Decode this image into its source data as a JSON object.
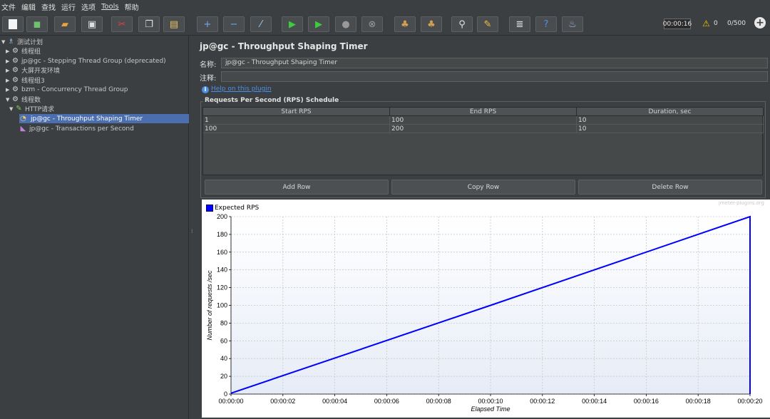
{
  "menu": [
    "文件",
    "编辑",
    "查找",
    "运行",
    "选项",
    "Tools",
    "帮助"
  ],
  "toolbar": {
    "elapsed": "00:00:16",
    "warning_count": "0",
    "threads": "0/500"
  },
  "tree": [
    {
      "label": "测试计划",
      "icon": "flask-icon",
      "depth": 0,
      "expanded": true
    },
    {
      "label": "线程组",
      "icon": "gear-icon",
      "depth": 1
    },
    {
      "label": "jp@gc - Stepping Thread Group (deprecated)",
      "icon": "gear-icon",
      "depth": 1
    },
    {
      "label": "大屏开发环境",
      "icon": "gear-icon",
      "depth": 1
    },
    {
      "label": "线程组3",
      "icon": "gear-icon",
      "depth": 1
    },
    {
      "label": "bzm - Concurrency Thread Group",
      "icon": "gear-icon",
      "depth": 1
    },
    {
      "label": "线程数",
      "icon": "gear-icon",
      "depth": 1,
      "expanded": true
    },
    {
      "label": "HTTP请求",
      "icon": "pencil-icon",
      "depth": 2,
      "expanded": true
    },
    {
      "label": "jp@gc - Throughput Shaping Timer",
      "icon": "timer-icon",
      "depth": 3,
      "selected": true
    },
    {
      "label": "jp@gc - Transactions per Second",
      "icon": "graph-icon",
      "depth": 3
    }
  ],
  "panel": {
    "title": "jp@gc - Throughput Shaping Timer",
    "name_label": "名称:",
    "name_value": "jp@gc - Throughput Shaping Timer",
    "comment_label": "注释:",
    "comment_value": "",
    "help_link": "Help on this plugin",
    "schedule_title": "Requests Per Second (RPS) Schedule",
    "columns": [
      "Start RPS",
      "End RPS",
      "Duration, sec"
    ],
    "rows": [
      [
        "1",
        "100",
        "10"
      ],
      [
        "100",
        "200",
        "10"
      ]
    ],
    "buttons": {
      "add": "Add Row",
      "copy": "Copy Row",
      "delete": "Delete Row"
    }
  },
  "chart_data": {
    "type": "line",
    "legend": "Expected RPS",
    "watermark": "jmeter-plugins.org",
    "xlabel": "Elapsed Time",
    "ylabel": "Number of requests /sec",
    "x_ticks": [
      "00:00:00",
      "00:00:02",
      "00:00:04",
      "00:00:06",
      "00:00:08",
      "00:00:10",
      "00:00:12",
      "00:00:14",
      "00:00:16",
      "00:00:18",
      "00:00:20"
    ],
    "y_ticks": [
      0,
      20,
      40,
      60,
      80,
      100,
      120,
      140,
      160,
      180,
      200
    ],
    "xlim": [
      0,
      20
    ],
    "ylim": [
      0,
      200
    ],
    "series": [
      {
        "name": "Expected RPS",
        "color": "#0000ff",
        "x": [
          0,
          10,
          20,
          20
        ],
        "y": [
          1,
          100,
          200,
          0
        ]
      }
    ],
    "grid": true,
    "legend_position": "top-left"
  }
}
